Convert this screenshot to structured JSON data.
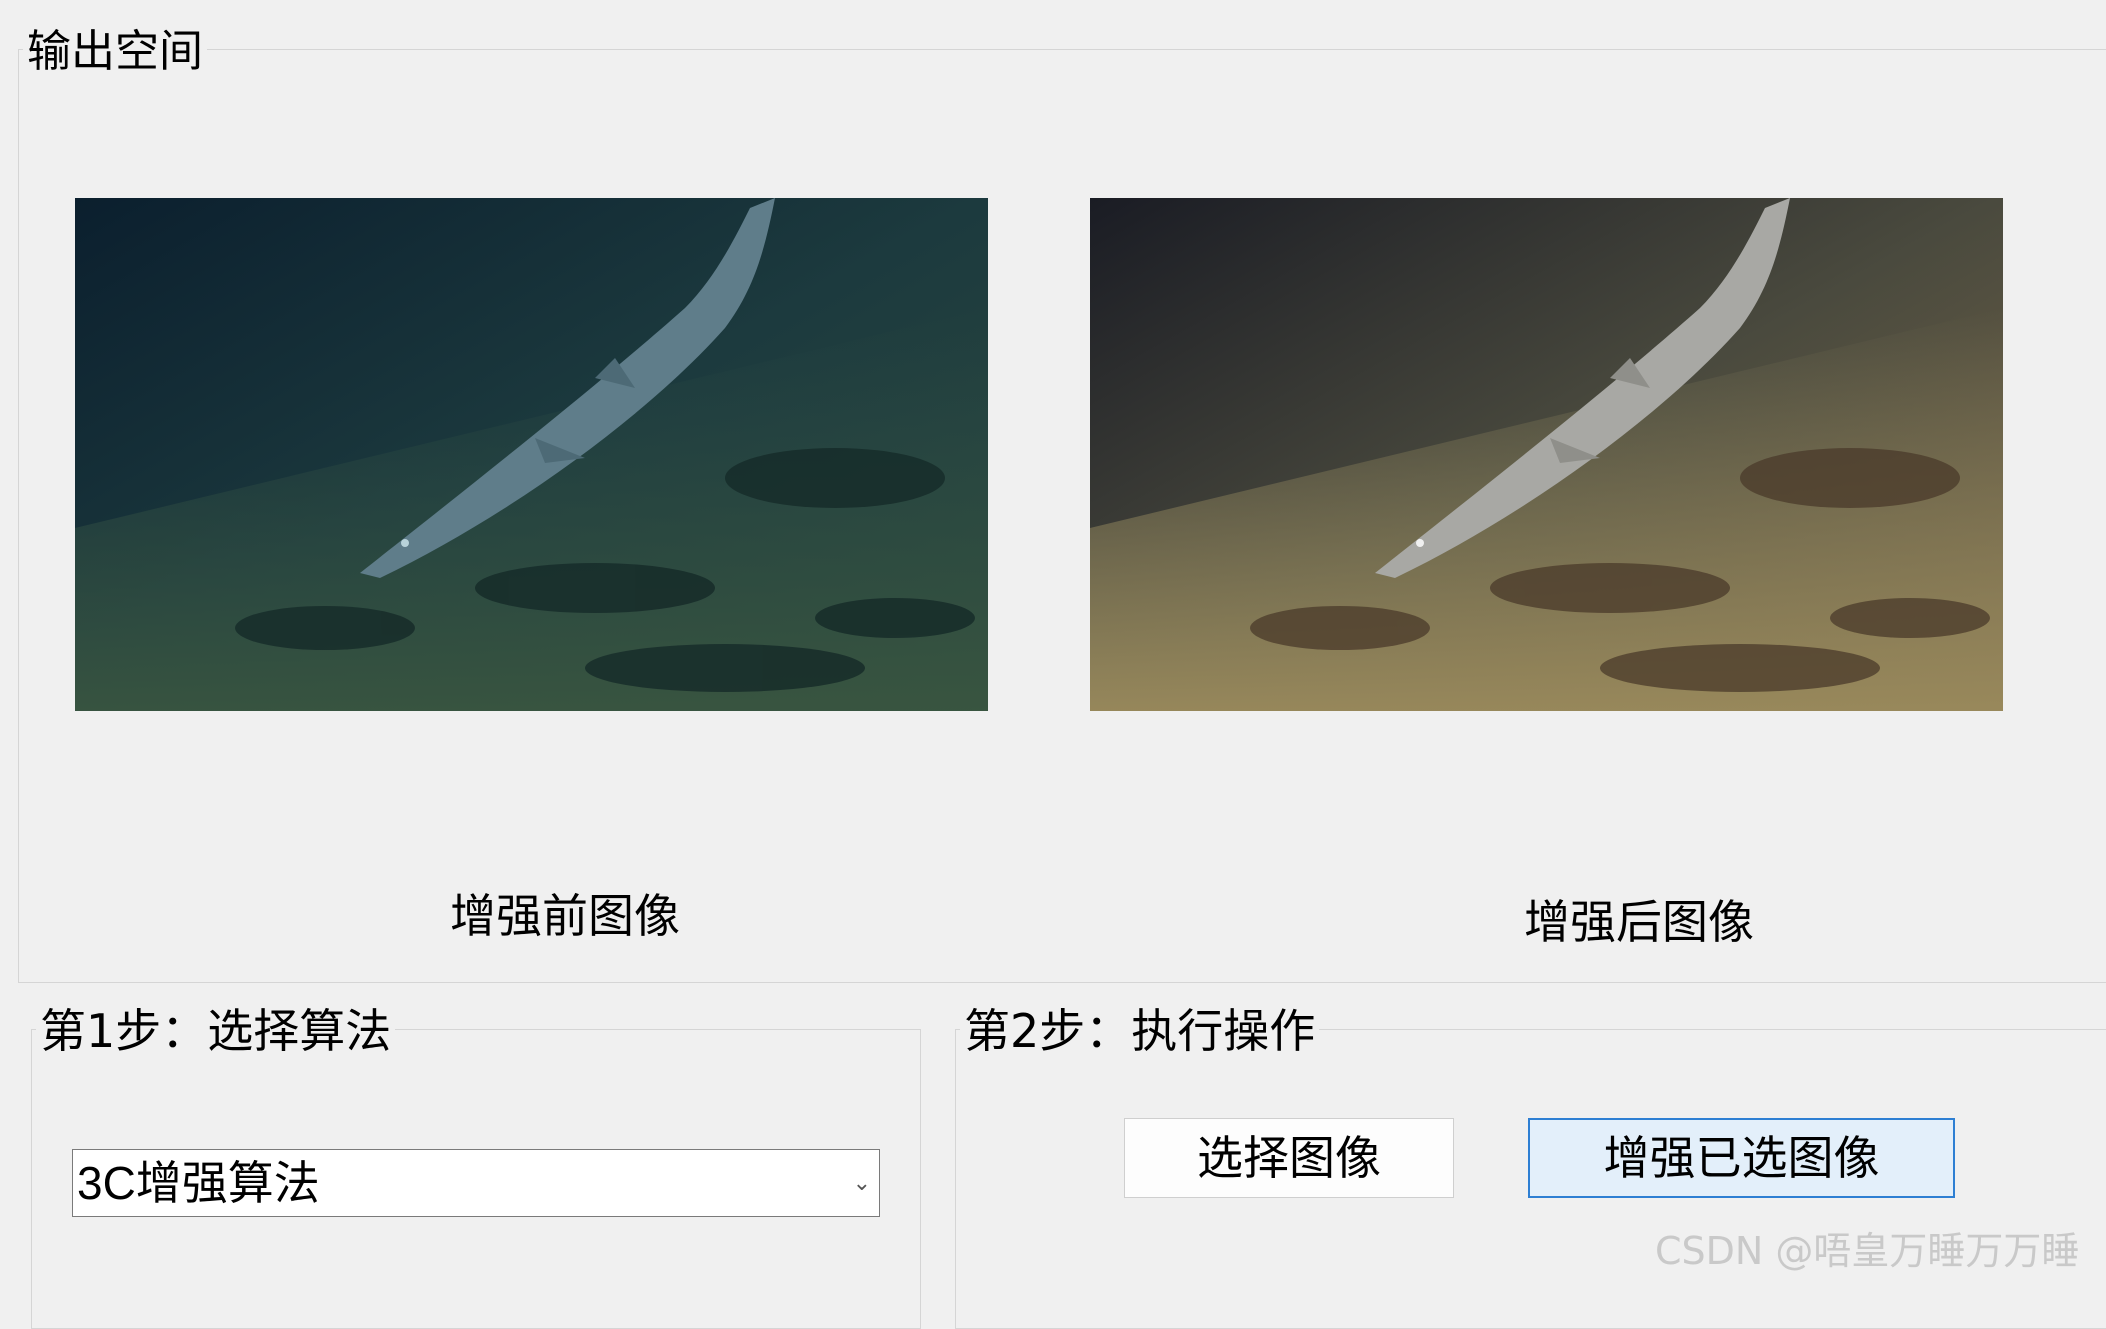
{
  "output_panel": {
    "title": "输出空间",
    "before_caption": "增强前图像",
    "after_caption": "增强后图像"
  },
  "step1": {
    "title": "第1步：选择算法",
    "algorithm_select": {
      "selected": "3C增强算法"
    }
  },
  "step2": {
    "title": "第2步：执行操作",
    "select_image_button": "选择图像",
    "enhance_button": "增强已选图像"
  },
  "watermark": "CSDN @唔皇万睡万万睡",
  "icons": {
    "dropdown": "chevron-down-icon"
  },
  "colors": {
    "window_bg": "#f0f0f0",
    "enhance_button_bg": "#e3effa",
    "enhance_button_border": "#2e7fd3"
  }
}
